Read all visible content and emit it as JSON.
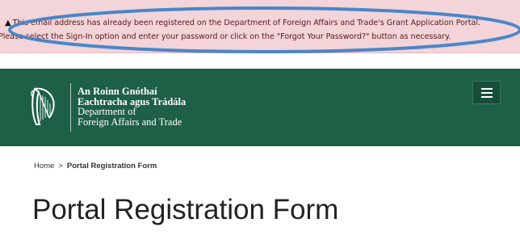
{
  "alert": {
    "icon": "warning-icon",
    "line1": "This email address has already been registered on the Department of Foreign Affairs and Trade's Grant Application Portal.",
    "line2": "Please select the Sign-In option and enter your password or click on the \"Forgot Your Password?\" button as necessary."
  },
  "header": {
    "logo_icon": "harp-icon",
    "irish_line1": "An Roinn Gnóthaí",
    "irish_line2": "Eachtracha agus Trádála",
    "english_line1": "Department of",
    "english_line2": "Foreign Affairs and Trade",
    "menu_icon": "hamburger-menu-icon",
    "background_color": "#1d6045"
  },
  "breadcrumb": {
    "home": "Home",
    "separator": ">",
    "current": "Portal Registration Form"
  },
  "page": {
    "title": "Portal Registration Form"
  },
  "colors": {
    "alert_background": "#f2d4d9",
    "highlight_ring": "#4a86c8"
  }
}
